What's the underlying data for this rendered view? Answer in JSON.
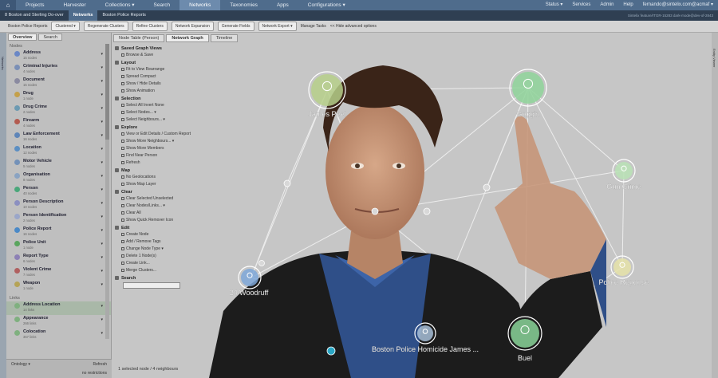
{
  "topnav": {
    "items": [
      "Projects",
      "Harvester",
      "Collections ▾",
      "Search",
      "Networks",
      "Taxonomies",
      "Apps",
      "Configurations ▾"
    ],
    "active_index": 4,
    "right": [
      "Status ▾",
      "Services",
      "Admin",
      "Help",
      "fernando@sintelix.com@acmaf ▾"
    ]
  },
  "crumbs": {
    "items": [
      "8 Boston and Sterling Do-over",
      "Networks",
      "Boston Police Reports"
    ],
    "version": "Sintelix feature/ITGR-15283 dark-mode@dev-of-2843"
  },
  "toolbar": {
    "report": "Boston Police Reports",
    "clustered": "Clustered ▾",
    "buttons": [
      "Regenerate Clusters",
      "Refine Clusters",
      "Network Expansion",
      "Generate Fields",
      "Network Export ▾"
    ],
    "manage": "Manage Tasks",
    "hide": "<< Hide advanced options"
  },
  "leftstrip": "Networks",
  "rightstrip": "Entity Viewer",
  "sidebar": {
    "tabs": [
      "Overview",
      "Search"
    ],
    "nodes_header": "Nodes",
    "nodes": [
      {
        "label": "Address",
        "sub": "15 nodes",
        "color": "#6a87c6"
      },
      {
        "label": "Criminal Injuries",
        "sub": "4 nodes",
        "color": "#7a8fb6"
      },
      {
        "label": "Document",
        "sub": "15 nodes",
        "color": "#8a8aa0"
      },
      {
        "label": "Drug",
        "sub": "1 node",
        "color": "#c4a04a"
      },
      {
        "label": "Drug Crime",
        "sub": "2 nodes",
        "color": "#6c9ab2"
      },
      {
        "label": "Firearm",
        "sub": "4 nodes",
        "color": "#b35b50"
      },
      {
        "label": "Law Enforcement",
        "sub": "16 nodes",
        "color": "#5e85b8"
      },
      {
        "label": "Location",
        "sub": "12 nodes",
        "color": "#5c8fc3"
      },
      {
        "label": "Motor Vehicle",
        "sub": "5 nodes",
        "color": "#7391b8"
      },
      {
        "label": "Organisation",
        "sub": "8 nodes",
        "color": "#8aa3c2"
      },
      {
        "label": "Person",
        "sub": "40 nodes",
        "color": "#4aa77a"
      },
      {
        "label": "Person Description",
        "sub": "10 nodes",
        "color": "#8b8fc0"
      },
      {
        "label": "Person Identification",
        "sub": "2 nodes",
        "color": "#9aa6c9"
      },
      {
        "label": "Police Report",
        "sub": "16 nodes",
        "color": "#4a89c7"
      },
      {
        "label": "Police Unit",
        "sub": "1 node",
        "color": "#5aa55e"
      },
      {
        "label": "Report Type",
        "sub": "6 nodes",
        "color": "#8d80b5"
      },
      {
        "label": "Violent Crime",
        "sub": "7 nodes",
        "color": "#b06060"
      },
      {
        "label": "Weapon",
        "sub": "1 node",
        "color": "#b5a356"
      }
    ],
    "links_header": "Links",
    "links": [
      {
        "label": "Address Location",
        "sub": "14 links",
        "color": "#7fb07f"
      },
      {
        "label": "Appearance",
        "sub": "266 links",
        "color": "#7fb07f"
      },
      {
        "label": "Colocation",
        "sub": "357 links",
        "color": "#7fb07f"
      }
    ],
    "ontology": "Ontology ▾",
    "refresh": "Refresh",
    "restrictions": "no restrictions"
  },
  "main_tabs": [
    "Node Table (Person)",
    "Network Graph",
    "Timeline"
  ],
  "main_tab_active": 1,
  "panel": [
    {
      "section": "Saved Graph Views",
      "items": [
        "Browse & Save"
      ]
    },
    {
      "section": "Layout",
      "items": [
        "Fit to View   Rearrange",
        "Spread   Compact",
        "Show / Hide Details",
        "Show Animation"
      ]
    },
    {
      "section": "Selection",
      "items": [
        "Select All   Invert   None",
        "Select Nodes...  ▾",
        "Select Neighbours...  ▾"
      ]
    },
    {
      "section": "Explore",
      "items": [
        "View or Edit Details / Custom Report",
        "Show More Neighbours...  ▾",
        "Show More Members",
        "Find Near Person",
        "Refresh"
      ]
    },
    {
      "section": "Map",
      "items": [
        "No Geolocations",
        "Show Map Layer"
      ]
    },
    {
      "section": "Clear",
      "items": [
        "Clear Selected   Unselected",
        "Clear Nodes/Links...  ▾",
        "Clear All",
        "Show Quick Remover Icon"
      ]
    },
    {
      "section": "Edit",
      "items": [
        "Create Node",
        "Add / Remove Tags",
        "Change Node Type  ▾",
        "Delete 1 Node(s)",
        "Create Link...",
        "Merge Clusters..."
      ]
    },
    {
      "section": "Search",
      "items": []
    }
  ],
  "graph": {
    "nodes": [
      {
        "id": "peel",
        "label": "James Peel",
        "color": "#b6cf8a"
      },
      {
        "id": "goggin",
        "label": "Goggin",
        "color": "#8fd39a"
      },
      {
        "id": "gun",
        "label": "Gun Crime",
        "color": "#b8e2b5"
      },
      {
        "id": "police",
        "label": "Police Reponse",
        "color": "#e5e2a8"
      },
      {
        "id": "woodruff",
        "label": "24 Woodruff",
        "color": "#7ea7d8"
      },
      {
        "id": "boston",
        "label": "Boston Police Homicide James ...",
        "color": "#a8c0d8"
      },
      {
        "id": "buel",
        "label": "Buel",
        "color": "#8ad399"
      }
    ]
  },
  "statusbar": "1 selected node  /  4 neighbours"
}
